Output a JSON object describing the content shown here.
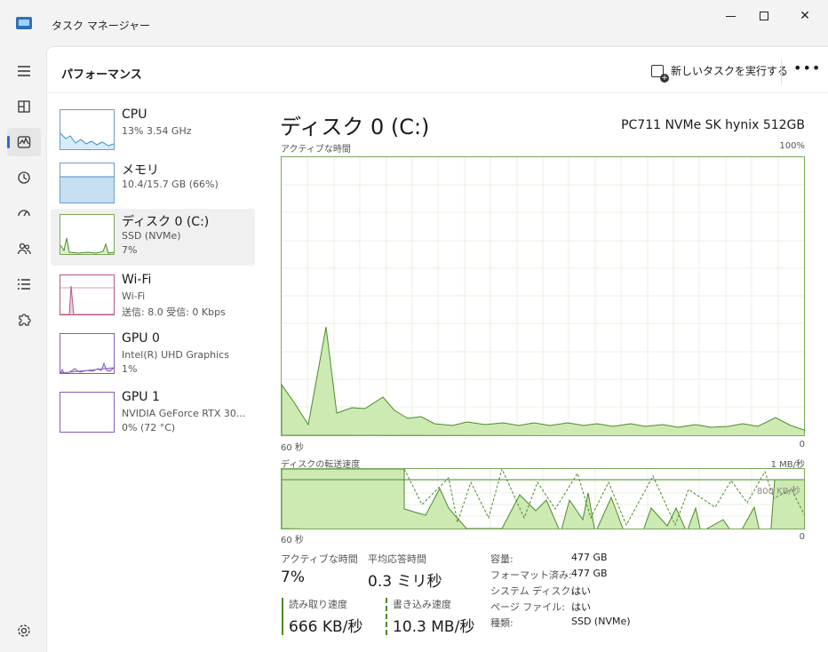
{
  "window": {
    "title": "タスク マネージャー"
  },
  "nav": {
    "items": [
      "menu",
      "processes",
      "performance",
      "history",
      "startup",
      "users",
      "details",
      "services"
    ],
    "settings": "settings"
  },
  "header": {
    "title": "パフォーマンス",
    "new_task_label": "新しいタスクを実行する",
    "more_label": "•••"
  },
  "devices": [
    {
      "name": "CPU",
      "sub1": "13%  3.54 GHz",
      "sub2": ""
    },
    {
      "name": "メモリ",
      "sub1": "10.4/15.7 GB (66%)",
      "sub2": ""
    },
    {
      "name": "ディスク 0 (C:)",
      "sub1": "SSD (NVMe)",
      "sub2": "7%"
    },
    {
      "name": "Wi-Fi",
      "sub1": "Wi-Fi",
      "sub2": "送信: 8.0  受信: 0 Kbps"
    },
    {
      "name": "GPU 0",
      "sub1": "Intel(R) UHD Graphics",
      "sub2": "1%"
    },
    {
      "name": "GPU 1",
      "sub1": "NVIDIA GeForce RTX 30...",
      "sub2": "0%  (72 °C)"
    }
  ],
  "detail": {
    "title": "ディスク 0 (C:)",
    "model": "PC711 NVMe SK hynix 512GB",
    "graph1": {
      "label": "アクティブな時間",
      "max": "100%",
      "xleft": "60 秒",
      "xright": "0"
    },
    "graph2": {
      "label": "ディスクの転送速度",
      "max": "1 MB/秒",
      "mid": "800 KB/秒",
      "xleft": "60 秒",
      "xright": "0"
    },
    "stats": {
      "active_label": "アクティブな時間",
      "active_value": "7%",
      "resp_label": "平均応答時間",
      "resp_value": "0.3 ミリ秒",
      "read_label": "読み取り速度",
      "read_value": "666 KB/秒",
      "write_label": "書き込み速度",
      "write_value": "10.3 MB/秒"
    },
    "props": [
      {
        "label": "容量:",
        "value": "477 GB"
      },
      {
        "label": "フォーマット済み:",
        "value": "477 GB"
      },
      {
        "label": "システム ディスク:",
        "value": "はい"
      },
      {
        "label": "ページ ファイル:",
        "value": "はい"
      },
      {
        "label": "種類:",
        "value": "SSD (NVMe)"
      }
    ]
  },
  "colors": {
    "disk_line": "#4e8a2a",
    "disk_fill": "#cdeab3",
    "accent": "#2a6ad4"
  }
}
